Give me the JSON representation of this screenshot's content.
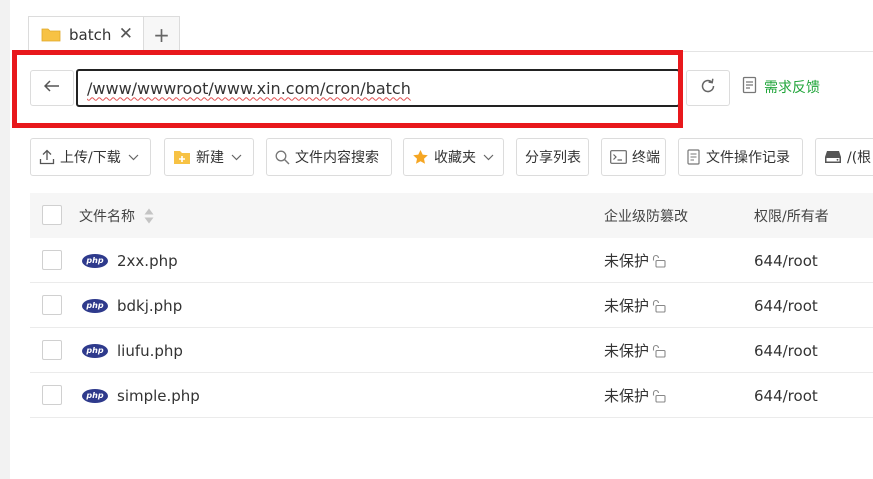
{
  "tab": {
    "label": "batch",
    "close": "✕",
    "add": "+"
  },
  "address": {
    "path": "/www/wwwroot/www.xin.com/cron/batch"
  },
  "feedback": {
    "label": "需求反馈"
  },
  "toolbar": {
    "upload_download": "上传/下载",
    "new": "新建",
    "content_search": "文件内容搜索",
    "favorites": "收藏夹",
    "share_list": "分享列表",
    "terminal": "终端",
    "operation_log": "文件操作记录",
    "root": "/(根"
  },
  "table": {
    "headers": {
      "name": "文件名称",
      "protection": "企业级防篡改",
      "perm": "权限/所有者"
    },
    "rows": [
      {
        "icon": "php",
        "name": "2xx.php",
        "protection": "未保护",
        "perm": "644/root"
      },
      {
        "icon": "php",
        "name": "bdkj.php",
        "protection": "未保护",
        "perm": "644/root"
      },
      {
        "icon": "php",
        "name": "liufu.php",
        "protection": "未保护",
        "perm": "644/root"
      },
      {
        "icon": "php",
        "name": "simple.php",
        "protection": "未保护",
        "perm": "644/root"
      }
    ]
  },
  "colors": {
    "accent": "#20a53a",
    "highlight": "#e8181c",
    "php_badge": "#2e3a8c",
    "folder": "#f7c244"
  }
}
